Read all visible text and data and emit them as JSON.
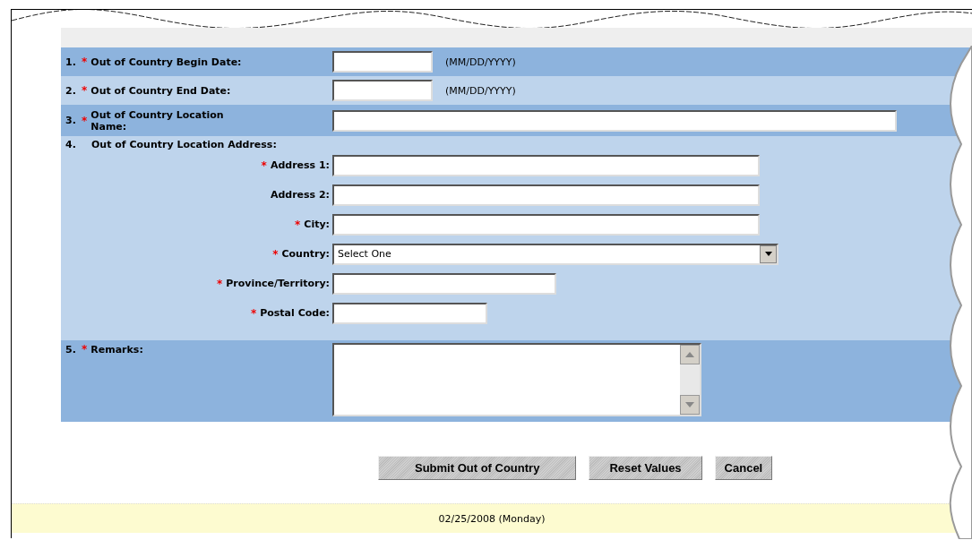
{
  "rows": [
    {
      "number": "1.",
      "mark": "*",
      "label": "Out of Country Begin Date:",
      "kind": "date",
      "hint": "(MM/DD/YYYY)"
    },
    {
      "number": "2.",
      "mark": "*",
      "label": "Out of Country End Date:",
      "kind": "date",
      "hint": "(MM/DD/YYYY)"
    },
    {
      "number": "3.",
      "mark": "*",
      "label": "Out of Country Location Name:",
      "kind": "text"
    }
  ],
  "address": {
    "number": "4.",
    "label": "Out of Country Location Address:",
    "fields": [
      {
        "mark": "*",
        "label": "Address 1:",
        "kind": "text"
      },
      {
        "label": "Address 2:",
        "kind": "text"
      },
      {
        "mark": "*",
        "label": "City:",
        "kind": "text"
      },
      {
        "mark": "*",
        "label": "Country:",
        "kind": "select",
        "value": "Select One"
      },
      {
        "mark": "*",
        "label": "Province/Territory:",
        "kind": "text"
      },
      {
        "mark": "*",
        "label": "Postal Code:",
        "kind": "text"
      }
    ]
  },
  "remarks": {
    "number": "5.",
    "mark": "*",
    "label": "Remarks:",
    "kind": "textarea"
  },
  "buttons": [
    "Submit Out of Country",
    "Reset Values",
    "Cancel"
  ],
  "footer": {
    "date": "02/25/2008 (Monday)"
  }
}
